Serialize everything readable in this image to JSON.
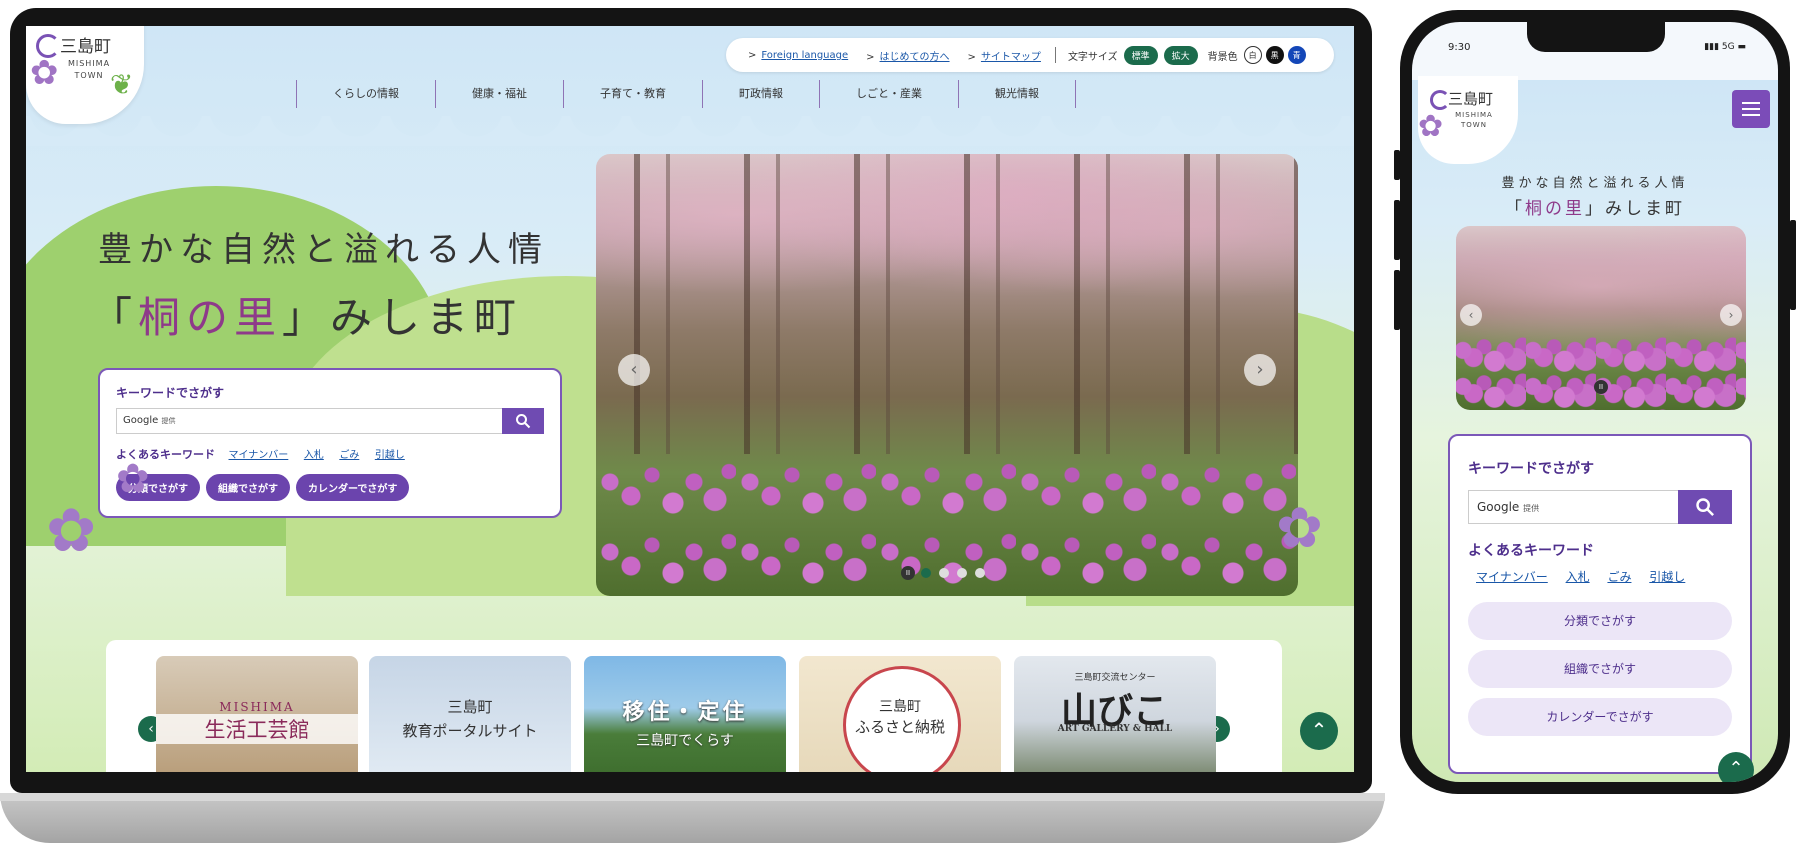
{
  "site": {
    "logo_title": "三島町",
    "logo_sub": "MISHIMA TOWN"
  },
  "utility": {
    "links": [
      "Foreign language",
      "はじめての方へ",
      "サイトマップ"
    ],
    "font_size_label": "文字サイズ",
    "font_size_standard": "標準",
    "font_size_large": "拡大",
    "bg_color_label": "背景色",
    "bg_white": "白",
    "bg_black": "黒",
    "bg_blue": "青"
  },
  "nav": [
    "くらしの情報",
    "健康・福祉",
    "子育て・教育",
    "町政情報",
    "しごと・産業",
    "観光情報"
  ],
  "hero": {
    "tagline1": "豊かな自然と溢れる人情",
    "tagline2_open": "「",
    "tagline2_highlight": "桐の里",
    "tagline2_rest": "」みしま町"
  },
  "search": {
    "title": "キーワードでさがす",
    "placeholder_brand": "Google",
    "placeholder_note": "提供",
    "keywords_label": "よくあるキーワード",
    "keywords": [
      "マイナンバー",
      "入札",
      "ごみ",
      "引越し"
    ],
    "buttons": [
      "分類でさがす",
      "組織でさがす",
      "カレンダーでさがす"
    ]
  },
  "slider": {
    "pause": "II",
    "dots": 4,
    "active_dot": 1
  },
  "banners": [
    {
      "line1": "MISHIMA",
      "line2": "生活工芸館"
    },
    {
      "line1": "三島町",
      "line2": "教育ポータルサイト"
    },
    {
      "line1": "移住・定住",
      "line2": "三島町でくらす"
    },
    {
      "line1": "三島町",
      "line2": "ふるさと納税"
    },
    {
      "line1": "三島町交流センター",
      "line2": "山びこ",
      "line3": "ART GALLERY & HALL"
    }
  ],
  "phone": {
    "time": "9:30",
    "network": "5G"
  },
  "colors": {
    "accent_purple": "#6f4bb2",
    "accent_green": "#1b6b4c",
    "link_blue": "#1a57a8"
  },
  "icons": [
    "search-icon",
    "chevron-left-icon",
    "chevron-right-icon",
    "pause-icon",
    "arrow-up-icon",
    "hamburger-menu-icon",
    "chevron-right-small-icon"
  ]
}
